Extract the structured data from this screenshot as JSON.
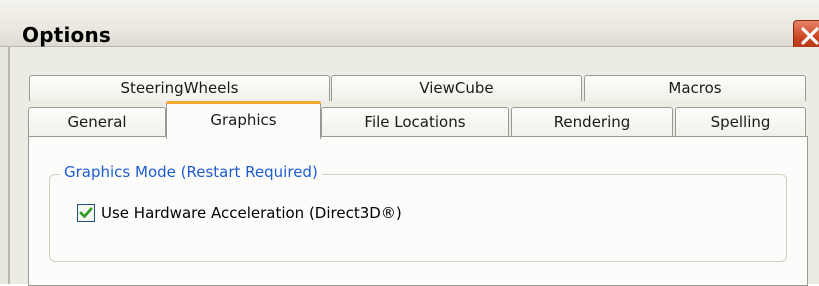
{
  "window": {
    "title": "Options"
  },
  "tabs": {
    "row1": [
      {
        "label": "SteeringWheels"
      },
      {
        "label": "ViewCube"
      },
      {
        "label": "Macros"
      }
    ],
    "row2": [
      {
        "label": "General"
      },
      {
        "label": "Graphics",
        "active": true
      },
      {
        "label": "File Locations"
      },
      {
        "label": "Rendering"
      },
      {
        "label": "Spelling"
      }
    ]
  },
  "graphics_panel": {
    "group_title": "Graphics Mode (Restart Required)",
    "hardware_acceleration": {
      "label": "Use Hardware Acceleration (Direct3D®)",
      "checked": true
    }
  },
  "colors": {
    "group_title": "#1e5bd2",
    "active_tab_accent": "#f0a830",
    "close_button": "#c9431f",
    "checkmark": "#2a9d1e"
  },
  "icons": {
    "close": "close-icon",
    "check": "checkmark-icon"
  }
}
